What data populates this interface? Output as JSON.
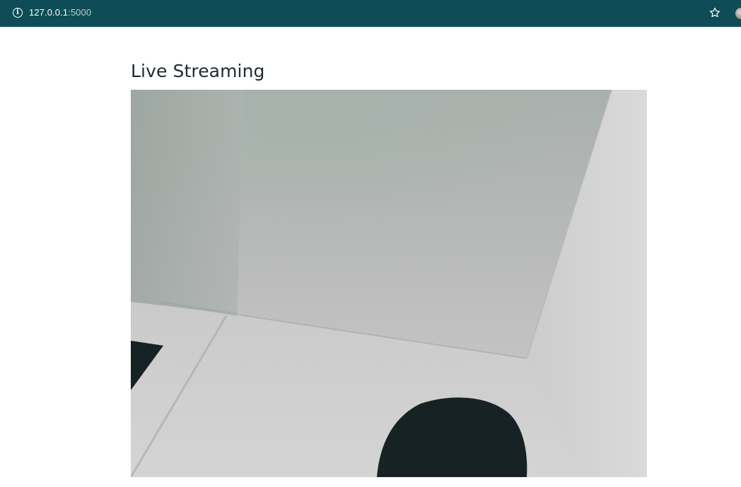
{
  "browser": {
    "url_host": "127.0.0.1",
    "url_port": ":5000",
    "info_icon": "info-icon",
    "bookmark_icon": "star-icon",
    "extension_icon": "extension-icon"
  },
  "page": {
    "title": "Live Streaming"
  },
  "stream": {
    "description_icon": "video-feed",
    "colors": {
      "wall_light": "#c9cbca",
      "wall_upper": "#a7aeaa",
      "floor": "#cfd1d0",
      "dark_object": "#172224"
    }
  },
  "colors": {
    "browser_bar": "#0e4d57",
    "title_text": "#1f2a30"
  }
}
